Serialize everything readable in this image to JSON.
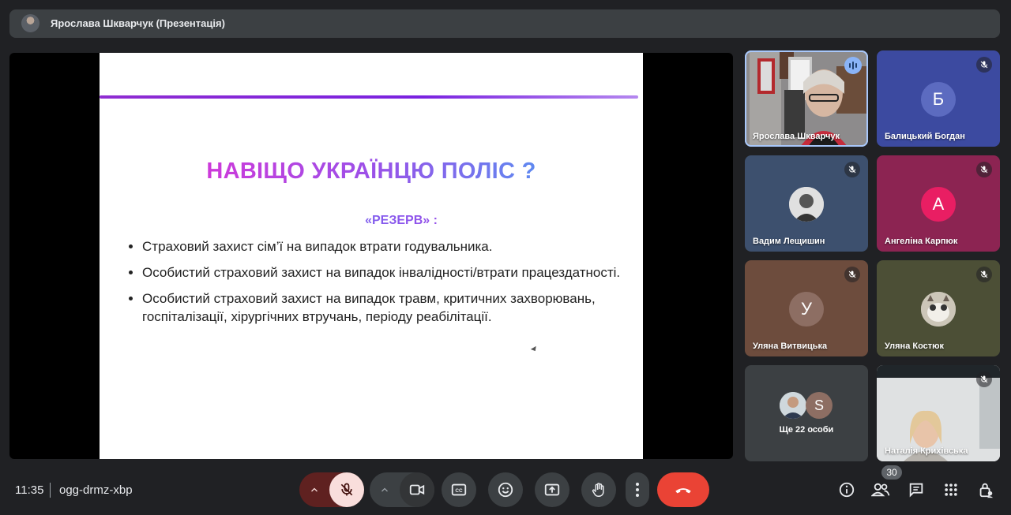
{
  "header": {
    "title": "Ярослава Шкварчук (Презентація)"
  },
  "slide": {
    "heading": "НАВІЩО УКРАЇНЦЮ ПОЛІС ?",
    "subheading": "«РЕЗЕРВ» :",
    "bullets": [
      "Страховий захист сім’ї на випадок втрати годувальника.",
      "Особистий страховий захист на випадок інвалідності/втрати працездатності.",
      "Особистий страховий захист на випадок травм, критичних захворювань, госпіталізації, хірургічних втручань, періоду реабілітації."
    ]
  },
  "participants": [
    {
      "name": "Ярослава Шкварчук",
      "type": "video",
      "speaking": true
    },
    {
      "name": "Балицький Богдан",
      "initial": "Б",
      "color": "#5c6bc0",
      "bg": "#3f51b5"
    },
    {
      "name": "Вадим Лещишин",
      "type": "photo",
      "bg": "#3b4f6f"
    },
    {
      "name": "Ангеліна Карпюк",
      "initial": "А",
      "color": "#e91e63",
      "bg": "#8d1d4e"
    },
    {
      "name": "Уляна Витвицька",
      "initial": "У",
      "color": "#8d6e63",
      "bg": "#6d4c41"
    },
    {
      "name": "Уляна Костюк",
      "type": "photo",
      "bg": "#4a4d33"
    },
    {
      "name": "Ще 22 особи",
      "initial": "S",
      "color": "#8d6e63"
    },
    {
      "name": "Наталія Крихівська",
      "type": "video"
    }
  ],
  "footer": {
    "time": "11:35",
    "meeting_code": "ogg-drmz-xbp",
    "participant_count": "30"
  },
  "colors": {
    "accent": "#8ab4f8",
    "end_call": "#ea4335",
    "mic_off": "#f9dedc"
  }
}
